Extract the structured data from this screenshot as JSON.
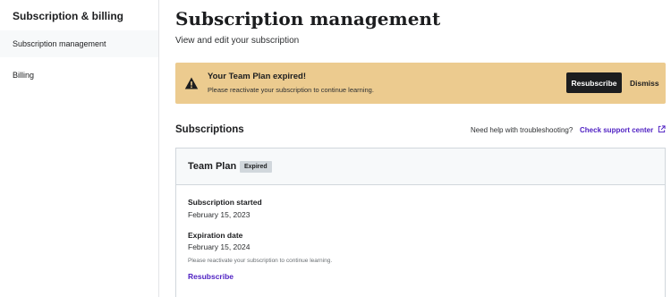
{
  "sidebar": {
    "heading": "Subscription & billing",
    "items": [
      {
        "label": "Subscription management",
        "active": true
      },
      {
        "label": "Billing",
        "active": false
      }
    ]
  },
  "header": {
    "title": "Subscription management",
    "subtitle": "View and edit your subscription"
  },
  "alert": {
    "icon": "warning-triangle-icon",
    "title": "Your Team Plan expired!",
    "message": "Please reactivate your subscription to continue learning.",
    "primary_label": "Resubscribe",
    "secondary_label": "Dismiss",
    "background": "#eccb8f"
  },
  "subscriptions": {
    "title": "Subscriptions",
    "help_text": "Need help with troubleshooting?",
    "support_link": "Check support center",
    "support_icon": "external-link-icon",
    "plan": {
      "name": "Team Plan",
      "status": "Expired",
      "started_label": "Subscription started",
      "started_value": "February 15, 2023",
      "expiration_label": "Expiration date",
      "expiration_value": "February 15, 2024",
      "note": "Please reactivate your subscription to continue learning.",
      "action_label": "Resubscribe"
    }
  },
  "colors": {
    "accent_link": "#5022c3",
    "primary_button": "#1c1d1f",
    "badge_bg": "#d1d7dc"
  }
}
